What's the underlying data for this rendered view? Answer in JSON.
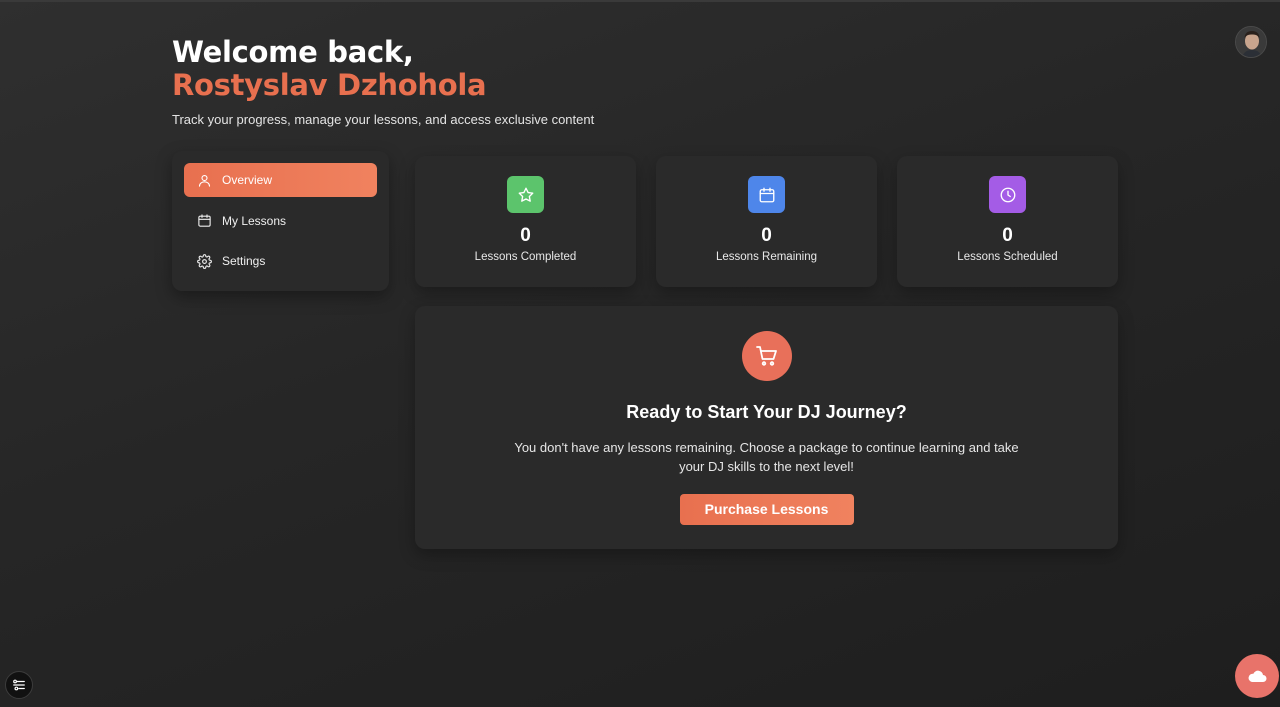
{
  "header": {
    "welcome": "Welcome back,",
    "user_name": "Rostyslav Dzhohola",
    "subtitle": "Track your progress, manage your lessons, and access exclusive content"
  },
  "sidebar": {
    "items": [
      {
        "label": "Overview",
        "icon": "user-icon",
        "active": true
      },
      {
        "label": "My Lessons",
        "icon": "calendar-icon",
        "active": false
      },
      {
        "label": "Settings",
        "icon": "gear-icon",
        "active": false
      }
    ]
  },
  "stats": [
    {
      "value": "0",
      "label": "Lessons Completed",
      "icon": "star-icon",
      "color": "#5cc46c"
    },
    {
      "value": "0",
      "label": "Lessons Remaining",
      "icon": "calendar-icon",
      "color": "#4e86ea"
    },
    {
      "value": "0",
      "label": "Lessons Scheduled",
      "icon": "clock-icon",
      "color": "#a45ce6"
    }
  ],
  "cta": {
    "icon": "cart-icon",
    "title": "Ready to Start Your DJ Journey?",
    "text": "You don't have any lessons remaining. Choose a package to continue learning and take your DJ skills to the next level!",
    "button_label": "Purchase Lessons"
  },
  "colors": {
    "accent": "#e8704f",
    "background": "#262626",
    "card": "#2a2a2a"
  }
}
